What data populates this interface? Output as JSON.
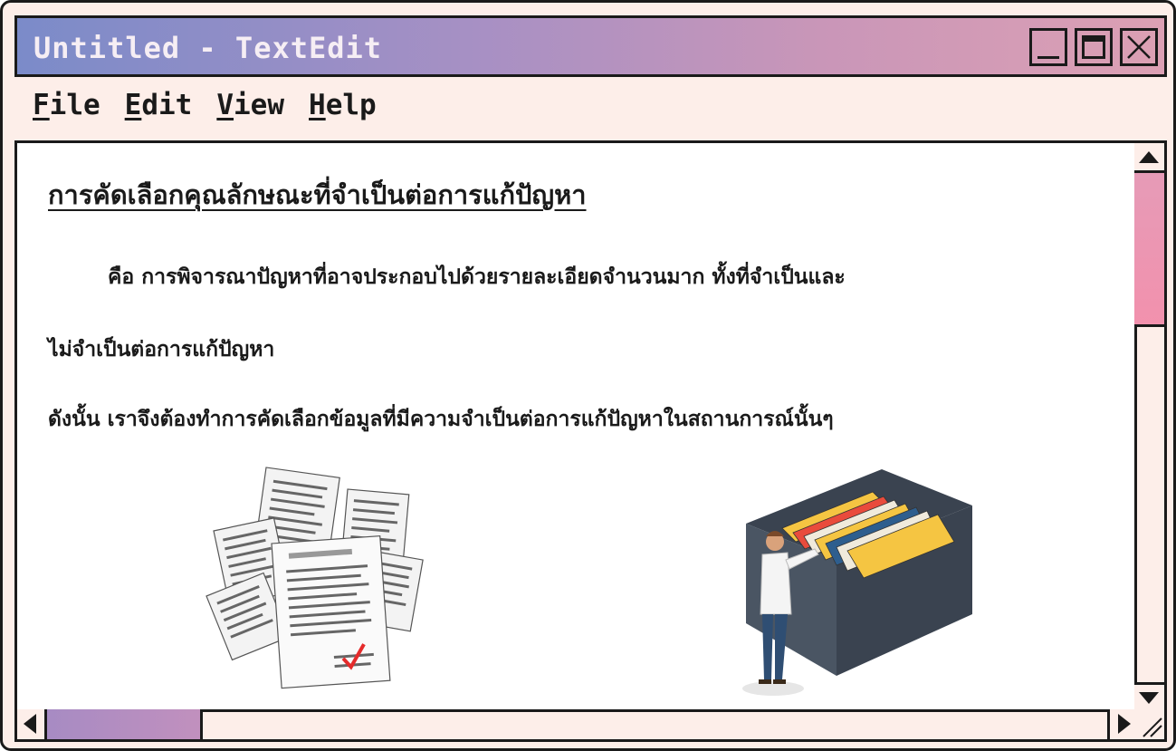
{
  "window": {
    "title": "Untitled - TextEdit",
    "controls": {
      "minimize": "minimize-icon",
      "maximize": "maximize-icon",
      "close": "close-icon"
    }
  },
  "menu": [
    {
      "accel": "F",
      "rest": "ile"
    },
    {
      "accel": "E",
      "rest": "dit"
    },
    {
      "accel": "V",
      "rest": "iew"
    },
    {
      "accel": "H",
      "rest": "elp"
    }
  ],
  "document": {
    "heading": "การคัดเลือกคุณลักษณะที่จำเป็นต่อการแก้ปัญหา",
    "paragraph1": "คือ การพิจารณาปัญหาที่อาจประกอบไปด้วยรายละเอียดจำนวนมาก ทั้งที่จำเป็นและ",
    "paragraph2": "ไม่จำเป็นต่อการแก้ปัญหา",
    "paragraph3": "ดังนั้น เราจึงต้องทำการคัดเลือกข้อมูลที่มีความจำเป็นต่อการแก้ปัญหาในสถานการณ์นั้นๆ"
  },
  "illustrations": {
    "left": "scattered-documents-illustration",
    "right": "person-filing-cabinet-illustration"
  },
  "colors": {
    "window_bg": "#fdeee9",
    "title_gradient": [
      "#7b8bc9",
      "#dca0b4"
    ],
    "vscroll_thumb": "#f291ad",
    "hscroll_thumb": "#b48cc1"
  }
}
